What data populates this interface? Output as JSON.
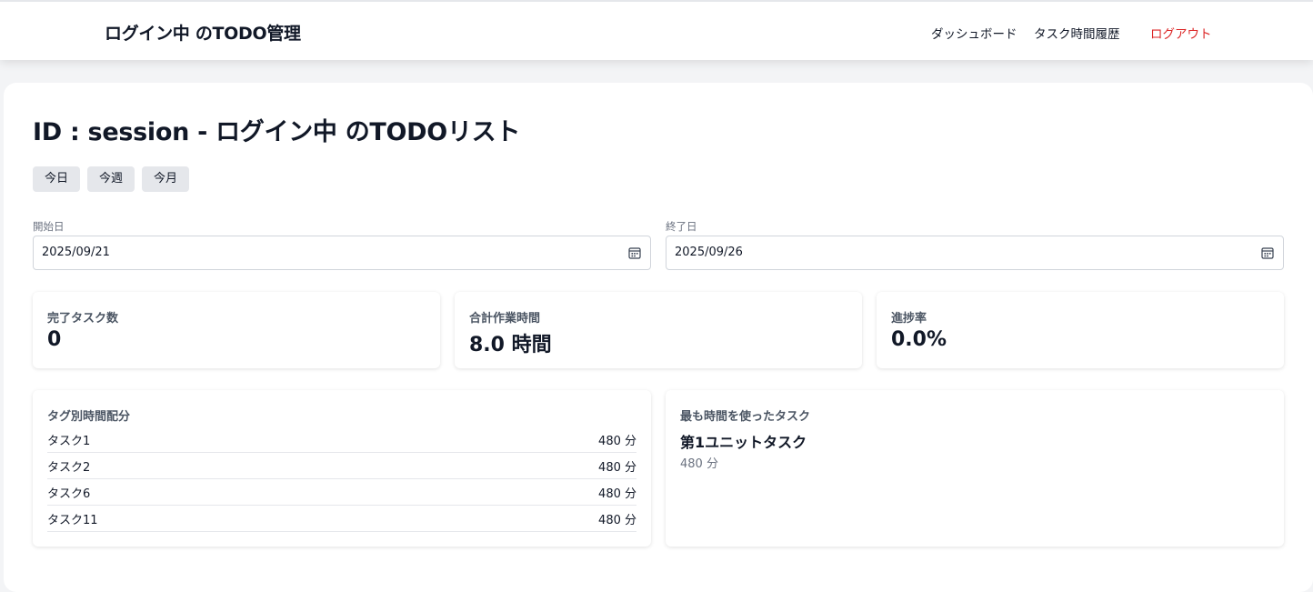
{
  "header": {
    "app_title": "ログイン中 のTODO管理",
    "nav": {
      "dashboard": "ダッシュボード",
      "history": "タスク時間履歴",
      "logout": "ログアウト"
    }
  },
  "page": {
    "title": "ID : session - ログイン中 のTODOリスト",
    "range_buttons": [
      "今日",
      "今週",
      "今月"
    ]
  },
  "filters": {
    "start_label": "開始日",
    "start_value": "2025/09/21",
    "end_label": "終了日",
    "end_value": "2025/09/26"
  },
  "stats": {
    "completed_label": "完了タスク数",
    "completed_value": "0",
    "total_label": "合計作業時間",
    "total_value": "8.0 時間",
    "progress_label": "進捗率",
    "progress_value": "0.0%"
  },
  "tag_breakdown": {
    "title": "タグ別時間配分",
    "rows": [
      {
        "name": "タスク1",
        "minutes": "480 分"
      },
      {
        "name": "タスク2",
        "minutes": "480 分"
      },
      {
        "name": "タスク6",
        "minutes": "480 分"
      },
      {
        "name": "タスク11",
        "minutes": "480 分"
      }
    ]
  },
  "top_task": {
    "title": "最も時間を使ったタスク",
    "name": "第1ユニットタスク",
    "minutes": "480 分"
  },
  "colors": {
    "logout": "#dc2626",
    "page_background": "#f3f4f6",
    "button_background": "#e5e7eb"
  },
  "icons": [
    "calendar-icon"
  ]
}
